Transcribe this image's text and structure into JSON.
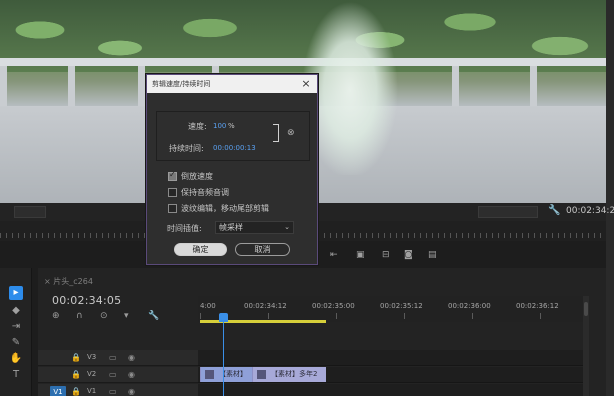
{
  "speed_dialog": {
    "title": "剪辑速度/持续时间",
    "close_glyph": "×",
    "speed_label": "速度:",
    "speed_value": "100",
    "speed_unit": "%",
    "duration_label": "持续时间:",
    "duration_value": "00:00:00:13",
    "link_icon": "chain-link-icon",
    "checkboxes": [
      {
        "label": "倒放速度",
        "checked": true
      },
      {
        "label": "保持音频音调",
        "checked": false
      },
      {
        "label": "波纹编辑，移动尾部剪辑",
        "checked": false
      }
    ],
    "interpolation_label": "时间插值:",
    "interpolation_value": "帧采样",
    "ok_label": "确定",
    "cancel_label": "取消"
  },
  "source_monitor": {
    "timecode": "00:02:34:2"
  },
  "sequence": {
    "tab_label": "片头_c264",
    "timecode": "00:02:34:05",
    "ruler_labels": [
      "4:00",
      "00:02:34:12",
      "00:02:35:00",
      "00:02:35:12",
      "00:02:36:00",
      "00:02:36:12"
    ],
    "tracks": [
      {
        "name": "V3",
        "source": ""
      },
      {
        "name": "V2",
        "source": ""
      },
      {
        "name": "V1",
        "source": "V1"
      }
    ],
    "clips": [
      {
        "label": "【素材】",
        "selected": true
      },
      {
        "label": "【素材】多年2",
        "selected": false
      }
    ]
  },
  "colors": {
    "accent_blue": "#3a8fe8",
    "work_area_yellow": "#d6cf3a",
    "clip_purple": "#a7a9d8",
    "dialog_border": "#5a4a7a"
  }
}
